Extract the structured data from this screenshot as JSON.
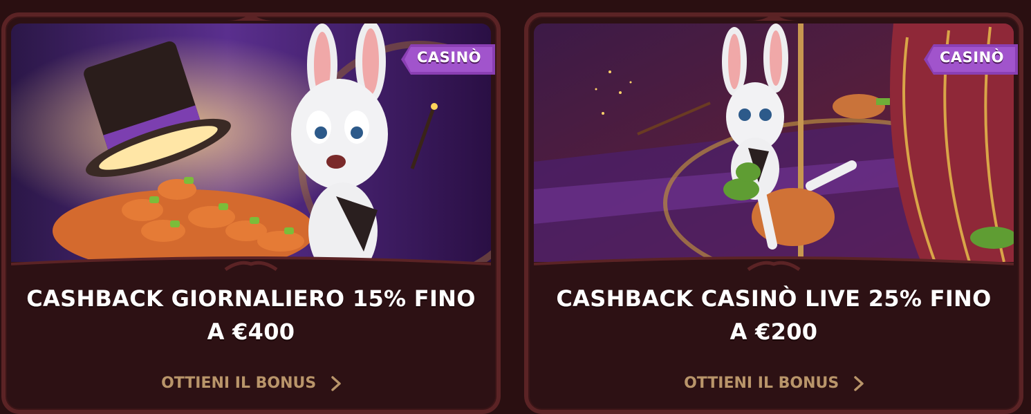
{
  "cards": [
    {
      "badge": "CASINÒ",
      "title_line1": "CASHBACK GIORNALIERO 15% FINO",
      "title_line2": "A €400",
      "cta": "OTTIENI IL BONUS"
    },
    {
      "badge": "CASINÒ",
      "title_line1": "CASHBACK CASINÒ LIVE 25% FINO",
      "title_line2": "A €200",
      "cta": "OTTIENI IL BONUS"
    }
  ],
  "colors": {
    "background": "#2a0f11",
    "card_border": "#5b2325",
    "card_fill": "#2d1114",
    "badge": "#8a3fb3",
    "cta": "#b9956a",
    "title": "#ffffff"
  },
  "icons": [
    "chevron-right-icon",
    "magic-hat-illustration",
    "rabbit-magician-illustration",
    "carousel-rabbit-illustration"
  ]
}
